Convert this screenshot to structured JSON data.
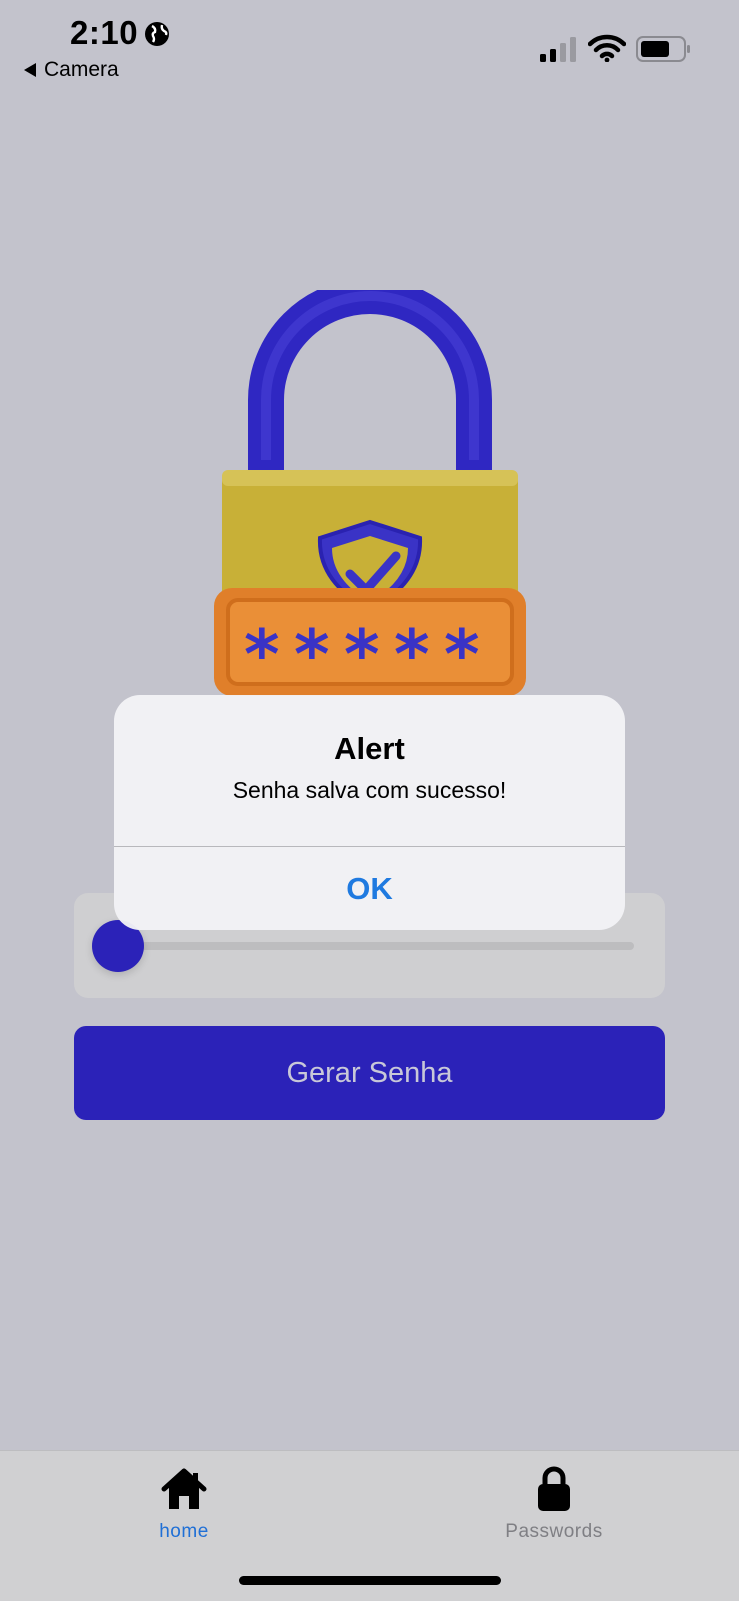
{
  "status_bar": {
    "time": "2:10",
    "back_label": "Camera",
    "icons": [
      "globe-icon",
      "signal-icon",
      "wifi-icon",
      "battery-icon"
    ]
  },
  "hero": {
    "image": "padlock-with-shield-and-password-illustration"
  },
  "slider": {
    "level": 0.0,
    "accent": "#2b22b8"
  },
  "generate_button": {
    "label": "Gerar Senha",
    "color": "#2b22b8"
  },
  "alert": {
    "title": "Alert",
    "message": "Senha salva com sucesso!",
    "ok_label": "OK",
    "button_color": "#1f7ae0"
  },
  "tab_bar": {
    "tabs": [
      {
        "label": "home",
        "icon": "home-icon",
        "active": true
      },
      {
        "label": "Passwords",
        "icon": "lock-icon",
        "active": false
      }
    ],
    "active_color": "#1f6fd6"
  }
}
